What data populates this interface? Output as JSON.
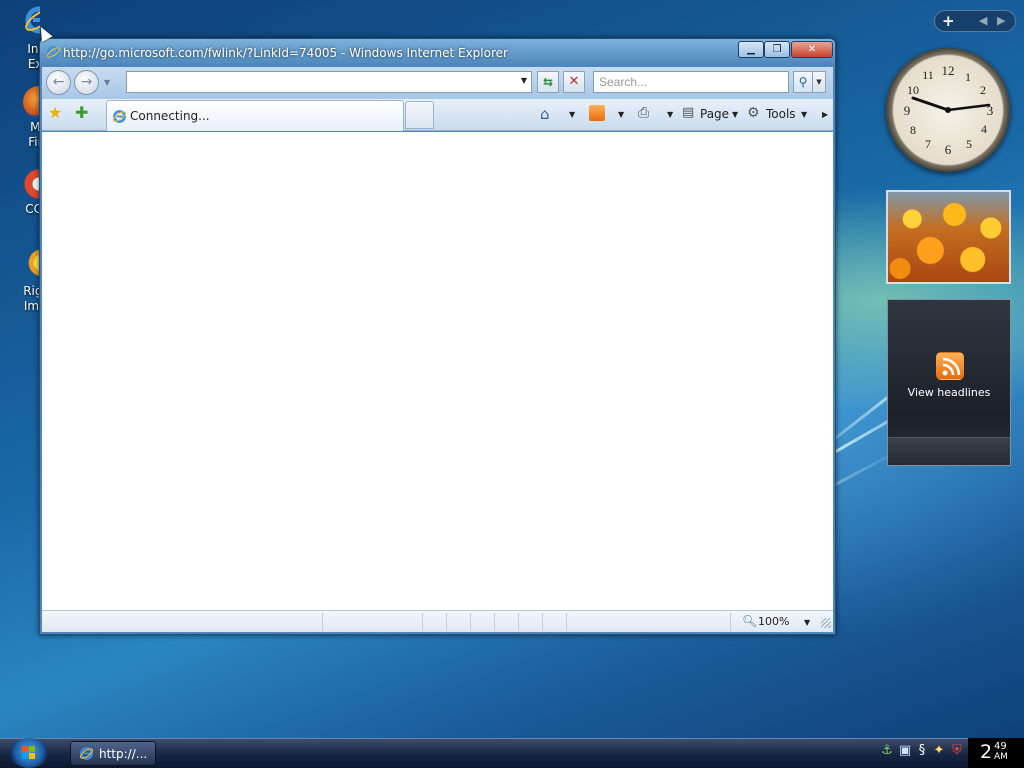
{
  "desktop": {
    "icons": [
      {
        "label": "Inte\nExp"
      },
      {
        "label": "Mo\nFire"
      },
      {
        "label": "CCle"
      },
      {
        "label": "Right\nImag"
      }
    ]
  },
  "window": {
    "title": "http://go.microsoft.com/fwlink/?LinkId=74005 - Windows Internet Explorer",
    "address": {
      "value": ""
    },
    "search": {
      "placeholder": "Search..."
    },
    "tab": {
      "label": "Connecting..."
    },
    "command_bar": {
      "page_label": "Page",
      "tools_label": "Tools"
    },
    "status": {
      "zoom": "100%"
    }
  },
  "sidebar": {
    "feeds_label": "View headlines"
  },
  "taskbar": {
    "task_label": "http://...",
    "clock": {
      "hour": "2",
      "minute": "49",
      "ampm": "AM"
    }
  },
  "colors": {
    "feed_orange": "#e56b0b",
    "close_red": "#c8432d"
  }
}
